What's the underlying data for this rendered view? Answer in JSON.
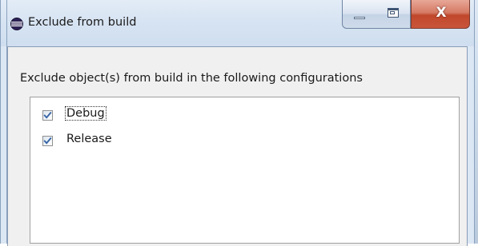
{
  "window": {
    "title": "Exclude from build",
    "close_glyph": "X"
  },
  "dialog": {
    "instruction": "Exclude object(s) from build in the following configurations"
  },
  "configurations": [
    {
      "label": "Debug",
      "checked": true,
      "focused": true
    },
    {
      "label": "Release",
      "checked": true,
      "focused": false
    }
  ],
  "icons": {
    "app": "eclipse-icon",
    "minimize": "minimize-icon",
    "maximize": "maximize-icon",
    "close": "close-icon",
    "check": "checkmark-icon"
  },
  "colors": {
    "titlebar": "#dce7f4",
    "close_button": "#c9553a",
    "client_background": "#f0f0f0",
    "check_mark": "#3563a5"
  }
}
